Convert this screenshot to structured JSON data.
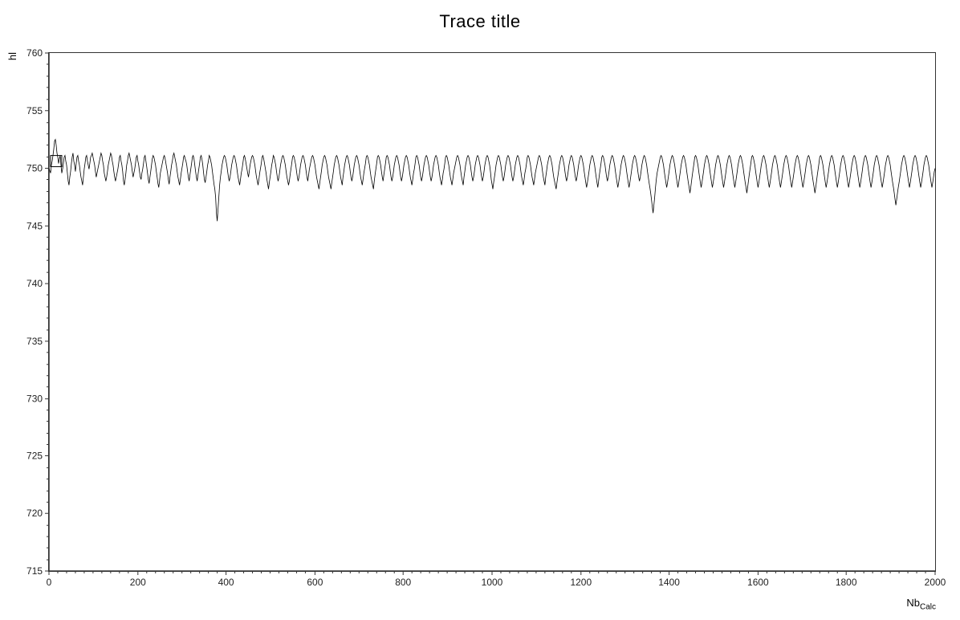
{
  "chart": {
    "title": "Trace title",
    "y_axis_label": "hl",
    "x_axis_label": "Nb",
    "x_axis_subscript": "Calc",
    "x_min": 0,
    "x_max": 2000,
    "y_min": 715,
    "y_max": 760,
    "y_ticks": [
      715,
      720,
      725,
      730,
      735,
      740,
      745,
      750,
      755,
      760
    ],
    "x_ticks": [
      0,
      200,
      400,
      600,
      800,
      1000,
      1200,
      1400,
      1600,
      1800,
      2000
    ]
  }
}
